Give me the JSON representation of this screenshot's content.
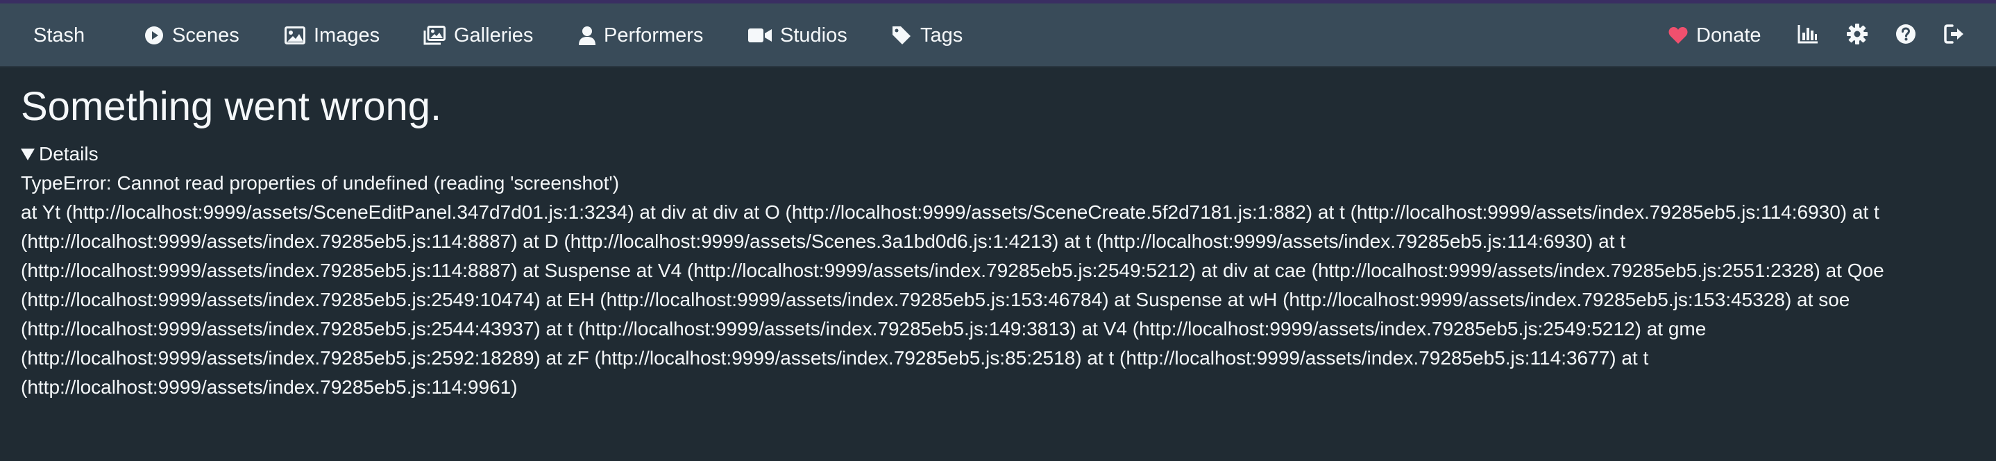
{
  "navbar": {
    "brand": "Stash",
    "items": [
      {
        "label": "Scenes",
        "icon": "play-circle-icon"
      },
      {
        "label": "Images",
        "icon": "image-icon"
      },
      {
        "label": "Galleries",
        "icon": "images-icon"
      },
      {
        "label": "Performers",
        "icon": "user-icon"
      },
      {
        "label": "Studios",
        "icon": "video-icon"
      },
      {
        "label": "Tags",
        "icon": "tag-icon"
      }
    ],
    "donate": {
      "label": "Donate",
      "icon": "heart-icon",
      "icon_color": "#f0506e"
    },
    "right_icons": [
      "stats-chart-icon",
      "gear-icon",
      "help-icon",
      "logout-icon"
    ]
  },
  "error": {
    "title": "Something went wrong.",
    "details_label": "Details",
    "message": "TypeError: Cannot read properties of undefined (reading 'screenshot')",
    "stack": "at Yt (http://localhost:9999/assets/SceneEditPanel.347d7d01.js:1:3234) at div at div at O (http://localhost:9999/assets/SceneCreate.5f2d7181.js:1:882) at t (http://localhost:9999/assets/index.79285eb5.js:114:6930) at t (http://localhost:9999/assets/index.79285eb5.js:114:8887) at D (http://localhost:9999/assets/Scenes.3a1bd0d6.js:1:4213) at t (http://localhost:9999/assets/index.79285eb5.js:114:6930) at t (http://localhost:9999/assets/index.79285eb5.js:114:8887) at Suspense at V4 (http://localhost:9999/assets/index.79285eb5.js:2549:5212) at div at cae (http://localhost:9999/assets/index.79285eb5.js:2551:2328) at Qoe (http://localhost:9999/assets/index.79285eb5.js:2549:10474) at EH (http://localhost:9999/assets/index.79285eb5.js:153:46784) at Suspense at wH (http://localhost:9999/assets/index.79285eb5.js:153:45328) at soe (http://localhost:9999/assets/index.79285eb5.js:2544:43937) at t (http://localhost:9999/assets/index.79285eb5.js:149:3813) at V4 (http://localhost:9999/assets/index.79285eb5.js:2549:5212) at gme (http://localhost:9999/assets/index.79285eb5.js:2592:18289) at zF (http://localhost:9999/assets/index.79285eb5.js:85:2518) at t (http://localhost:9999/assets/index.79285eb5.js:114:3677) at t (http://localhost:9999/assets/index.79285eb5.js:114:9961)"
  }
}
